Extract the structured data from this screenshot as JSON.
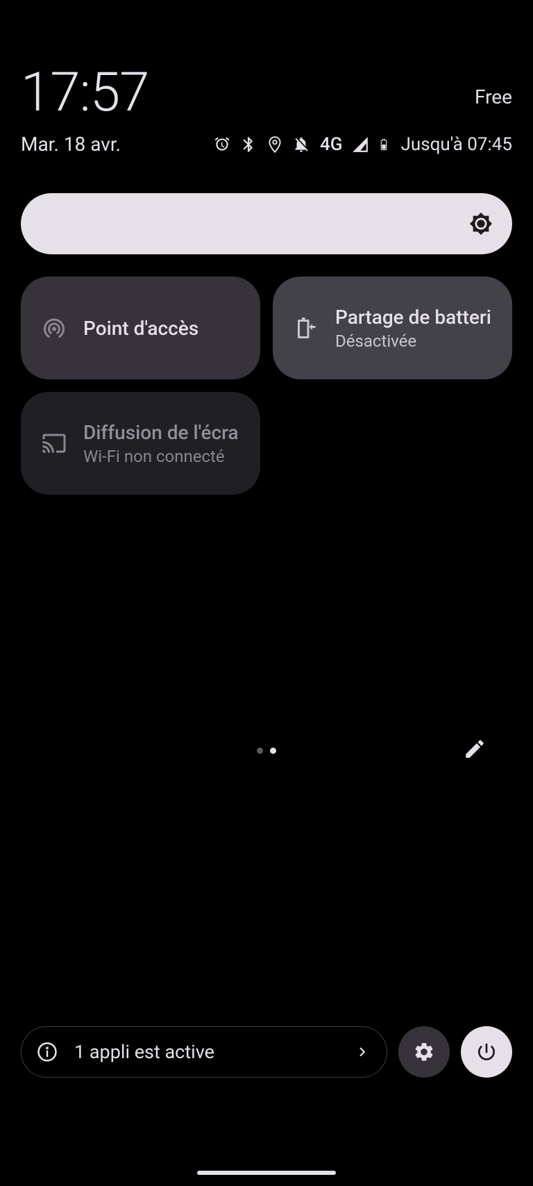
{
  "clock": "17:57",
  "carrier": "Free",
  "date": "Mar. 18 avr.",
  "status": {
    "network_label": "4G",
    "battery_time": "Jusqu'à 07:45"
  },
  "tiles": [
    {
      "title": "Point d'accès",
      "subtitle": ""
    },
    {
      "title": "Partage de batterie",
      "subtitle": "Désactivée"
    },
    {
      "title": "Diffusion de l'écran",
      "subtitle": "Wi-Fi non connecté"
    }
  ],
  "bottom": {
    "active_app": "1 appli est active"
  }
}
